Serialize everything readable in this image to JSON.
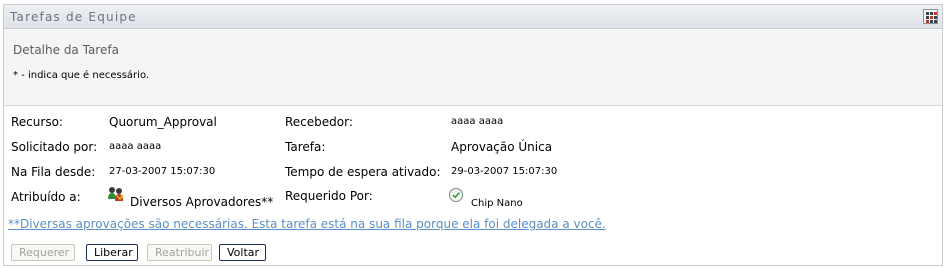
{
  "portlet": {
    "title": "Tarefas de Equipe"
  },
  "header": {
    "section_title": "Detalhe da Tarefa",
    "required_note": "* - indica que é necessário."
  },
  "fields": {
    "recurso_label": "Recurso:",
    "recurso_value": "Quorum_Approval",
    "recebedor_label": "Recebedor:",
    "recebedor_value": "aaaa aaaa",
    "solicitado_label": "Solicitado por:",
    "solicitado_value": "aaaa aaaa",
    "tarefa_label": "Tarefa:",
    "tarefa_value": "Aprovação Única",
    "fila_label": "Na Fila desde:",
    "fila_value": "27-03-2007 15:07:30",
    "tempo_label": "Tempo de espera ativado:",
    "tempo_value": "29-03-2007 15:07:30",
    "atribuido_label": "Atribuído a:",
    "atribuido_value": "Diversos Aprovadores**",
    "requerido_label": "Requerido Por:",
    "requerido_value": "Chip Nano"
  },
  "note": "**Diversas aprovações são necessárias. Esta tarefa está na sua fila porque ela foi delegada a você.",
  "buttons": {
    "requerer": "Requerer",
    "liberar": "Liberar",
    "reatribuir": "Reatribuir",
    "voltar": "Voltar"
  },
  "icons": {
    "menu": "portlet-menu-icon",
    "group": "group-icon",
    "check": "check-circle-icon"
  }
}
